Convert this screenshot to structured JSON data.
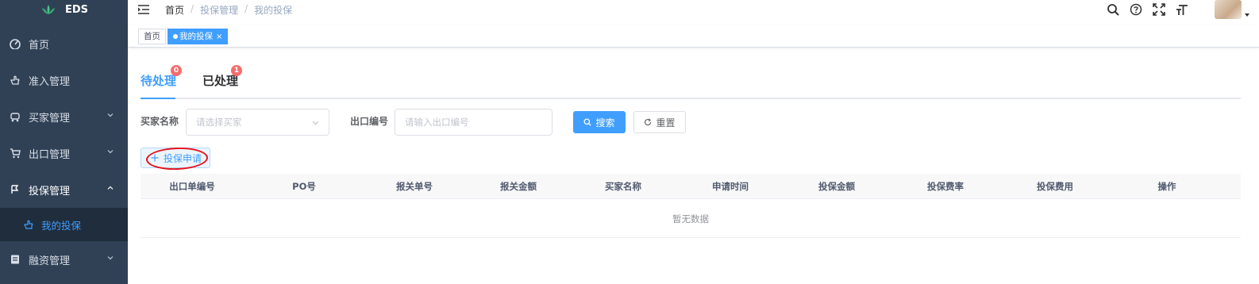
{
  "app": {
    "logo_text": "EDS"
  },
  "sidebar": {
    "items": [
      {
        "label": "首页",
        "icon": "dashboard-icon",
        "has_children": false
      },
      {
        "label": "准入管理",
        "icon": "hand-icon",
        "has_children": false
      },
      {
        "label": "买家管理",
        "icon": "car-icon",
        "has_children": true
      },
      {
        "label": "出口管理",
        "icon": "cart-icon",
        "has_children": true
      },
      {
        "label": "投保管理",
        "icon": "flag-icon",
        "has_children": true,
        "expanded": true
      },
      {
        "label": "融资管理",
        "icon": "document-icon",
        "has_children": true
      }
    ],
    "submenu": {
      "label": "我的投保",
      "icon": "hand-point-icon"
    }
  },
  "navbar": {
    "breadcrumb": [
      "首页",
      "投保管理",
      "我的投保"
    ],
    "breadcrumb_sep": "/",
    "icons": [
      "search-icon",
      "help-icon",
      "fullscreen-icon",
      "font-size-icon"
    ]
  },
  "tags": [
    {
      "label": "首页",
      "active": false
    },
    {
      "label": "我的投保",
      "active": true,
      "close": "×"
    }
  ],
  "tabs": [
    {
      "label": "待处理",
      "badge": "0",
      "active": true
    },
    {
      "label": "已处理",
      "badge": "1",
      "active": false
    }
  ],
  "filters": {
    "buyer_label": "买家名称",
    "buyer_placeholder": "请选择买家",
    "export_label": "出口编号",
    "export_placeholder": "请输入出口编号",
    "search_button": "搜索",
    "reset_button": "重置"
  },
  "actions": {
    "apply_button": "投保申请",
    "apply_icon": "plus-icon"
  },
  "table": {
    "columns": [
      "出口单编号",
      "PO号",
      "报关单号",
      "报关金额",
      "买家名称",
      "申请时间",
      "投保金额",
      "投保费率",
      "投保费用",
      "操作"
    ],
    "empty_text": "暂无数据"
  },
  "colors": {
    "primary": "#409eff",
    "sidebar_bg": "#304156",
    "badge": "#f56c6c",
    "annotation": "#e5121b"
  }
}
